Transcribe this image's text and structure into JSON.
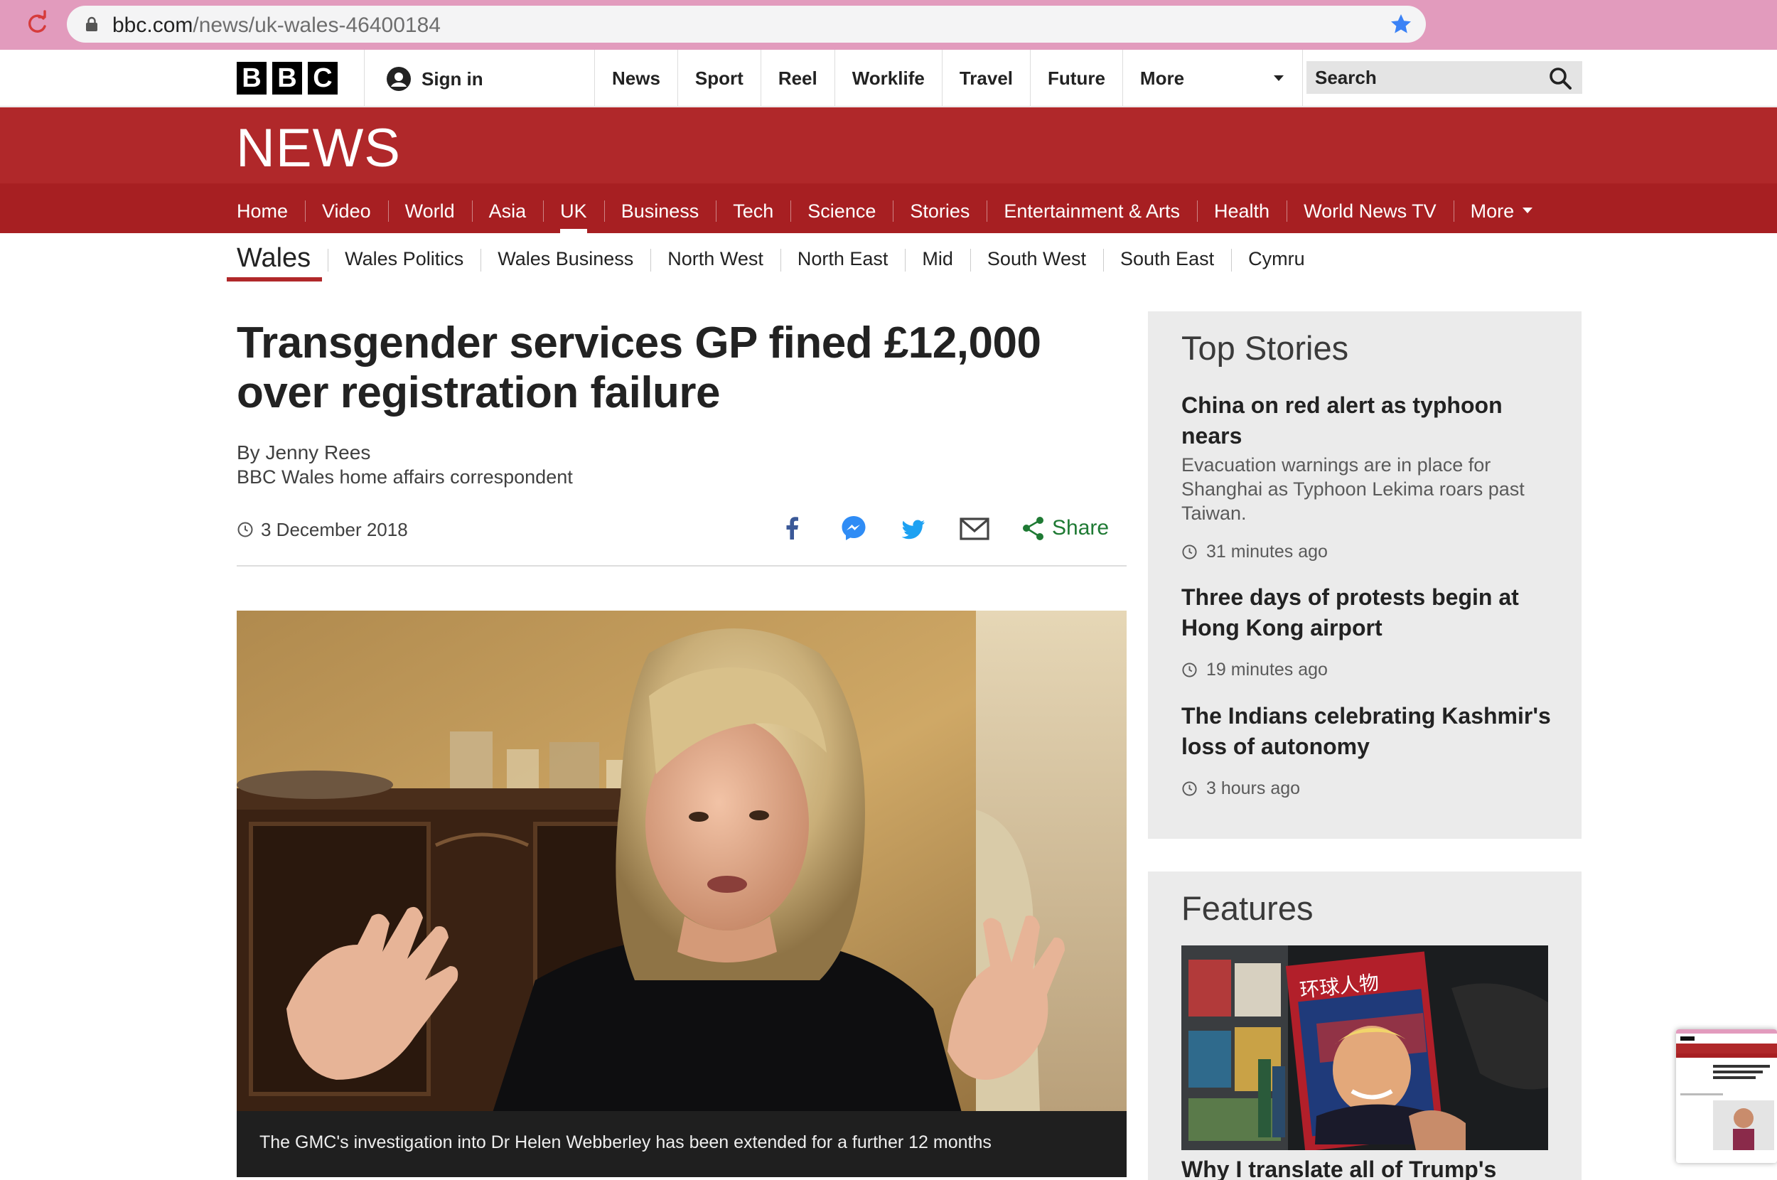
{
  "browser": {
    "url_domain": "bbc.com",
    "url_path": "/news/uk-wales-46400184"
  },
  "masthead": {
    "logo_letters": [
      "B",
      "B",
      "C"
    ],
    "sign_in": "Sign in",
    "nav": [
      "News",
      "Sport",
      "Reel",
      "Worklife",
      "Travel",
      "Future"
    ],
    "more": "More",
    "search_placeholder": "Search"
  },
  "news": {
    "logo": "NEWS",
    "sections": [
      "Home",
      "Video",
      "World",
      "Asia",
      "UK",
      "Business",
      "Tech",
      "Science",
      "Stories",
      "Entertainment & Arts",
      "Health",
      "World News TV"
    ],
    "active_section": "UK",
    "more": "More"
  },
  "subnav": {
    "title": "Wales",
    "items": [
      "Wales Politics",
      "Wales Business",
      "North West",
      "North East",
      "Mid",
      "South West",
      "South East",
      "Cymru"
    ]
  },
  "article": {
    "headline": "Transgender services GP fined £12,000 over registration failure",
    "byline": "By Jenny Rees",
    "role": "BBC Wales home affairs correspondent",
    "date": "3 December 2018",
    "share_label": "Share",
    "caption": "The GMC's investigation into Dr Helen Webberley has been extended for a further 12 months"
  },
  "sidebar": {
    "top_stories_title": "Top Stories",
    "stories": [
      {
        "headline": "China on red alert as typhoon nears",
        "summary": "Evacuation warnings are in place for Shanghai as Typhoon Lekima roars past Taiwan.",
        "time": "31 minutes ago"
      },
      {
        "headline": "Three days of protests begin at Hong Kong airport",
        "summary": "",
        "time": "19 minutes ago"
      },
      {
        "headline": "The Indians celebrating Kashmir's loss of autonomy",
        "summary": "",
        "time": "3 hours ago"
      }
    ],
    "features_title": "Features",
    "feature_headline": "Why I translate all of Trump's",
    "feature_magazine_text": "环球人物"
  },
  "colors": {
    "chrome": "#e29bbd",
    "bbc_red": "#b0282a",
    "nav_red": "#a71f22",
    "share_green": "#1f7a34",
    "star_blue": "#3b82f6"
  }
}
